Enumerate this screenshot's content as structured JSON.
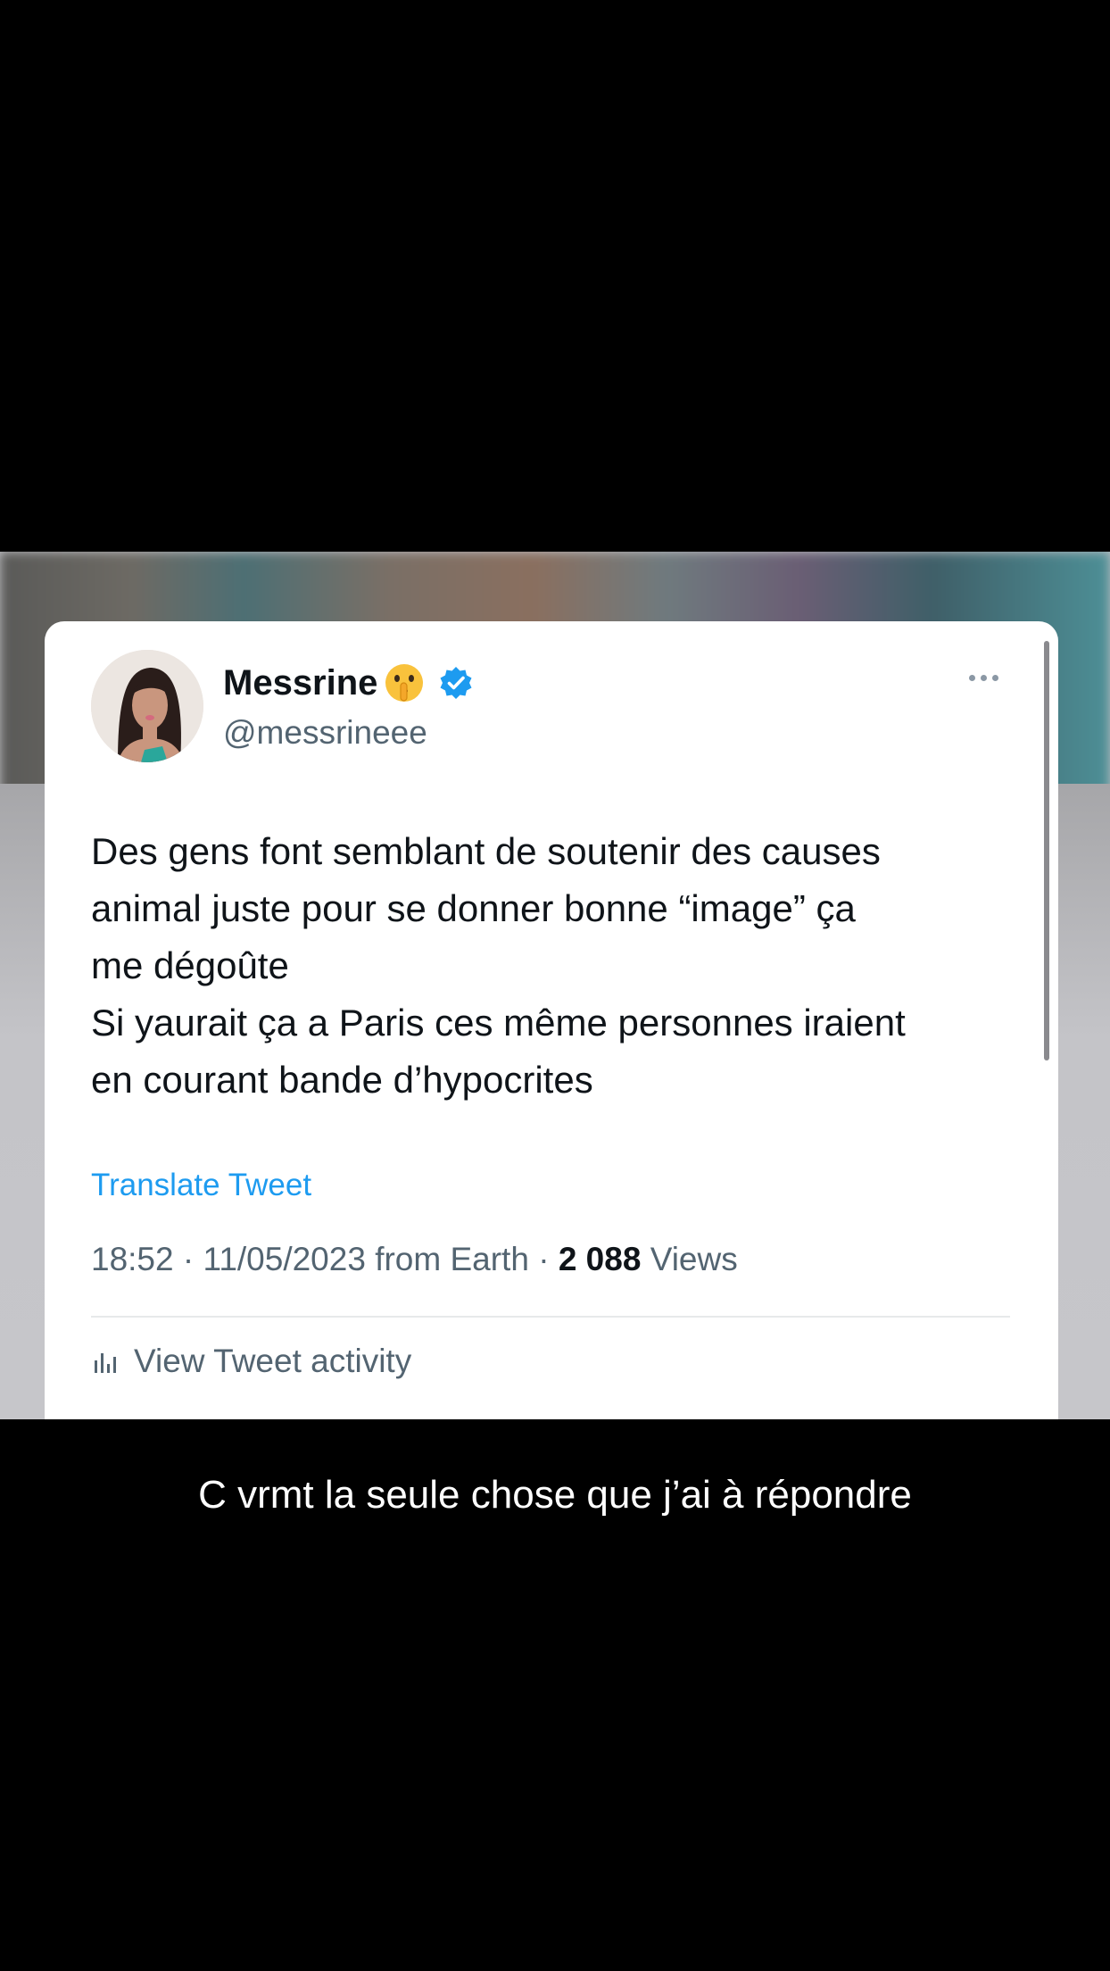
{
  "tweet": {
    "display_name": "Messrine",
    "emoji_icon": "shushing-face-emoji",
    "verified_icon": "verified-badge-icon",
    "handle": "@messrineee",
    "text_lines": [
      "Des gens font semblant de soutenir des causes",
      "animal juste pour se donner bonne “image” ça",
      "me dégoûte",
      "Si yaurait ça a Paris ces même personnes iraient",
      "en courant bande d’hypocrites"
    ],
    "translate_label": "Translate Tweet",
    "time": "18:52",
    "date": "11/05/2023",
    "source": "from Earth",
    "views_count": "2 088",
    "views_label": "Views",
    "activity_label": "View Tweet activity",
    "accent_color": "#1d9bf0"
  },
  "caption": "C vrmt la seule chose que j’ai à répondre"
}
